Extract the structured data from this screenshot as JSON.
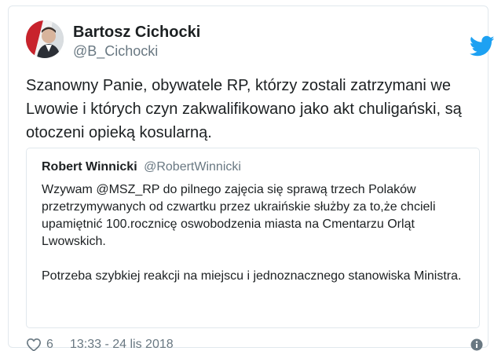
{
  "tweet": {
    "author": {
      "display_name": "Bartosz Cichocki",
      "handle": "@B_Cichocki"
    },
    "text": "Szanowny Panie, obywatele RP, którzy zostali zatrzymani we Lwowie i których czyn zakwalifikowano jako akt chuligański, są otoczeni opieką kosularną.",
    "quoted": {
      "display_name": "Robert Winnicki",
      "handle": "@RobertWinnicki",
      "paragraphs": [
        "Wzywam @MSZ_RP do pilnego zajęcia się sprawą trzech Polaków przetrzymywanych od czwartku przez ukraińskie służby za to,że chcieli upamiętnić 100.rocznicę oswobodzenia miasta na Cmentarzu Orląt Lwowskich.",
        "Potrzeba szybkiej reakcji na miejscu i jednoznacznego stanowiska Ministra."
      ]
    },
    "likes": "6",
    "timestamp": "13:33 - 24 lis 2018"
  },
  "colors": {
    "brand_blue": "#1da1f2",
    "text": "#1c2022",
    "muted": "#697882",
    "border": "#e1e8ed"
  },
  "icons": {
    "brand": "twitter-bird-icon",
    "like": "heart-icon",
    "info": "info-icon"
  }
}
